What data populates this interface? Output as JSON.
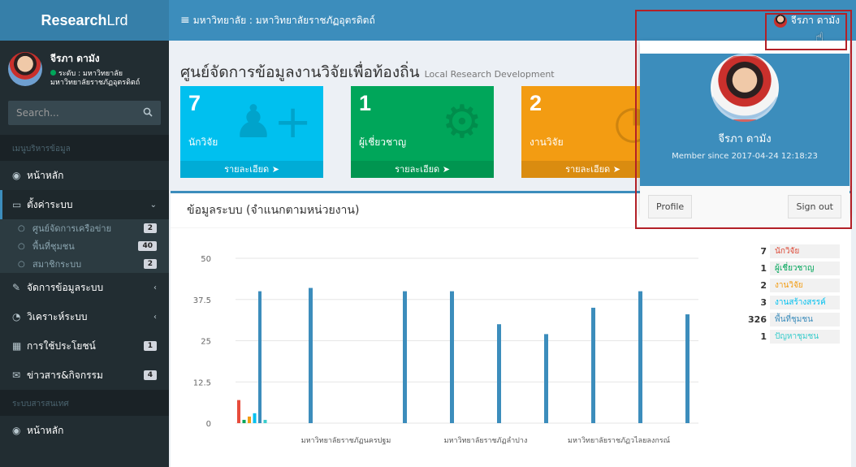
{
  "sidebar": {
    "logo_bold": "Research",
    "logo_rest": "Lrd",
    "user": {
      "name": "จีรภา ดามัง",
      "status_line1": "ระดับ : มหาวิทยาลัย",
      "status_line2": "มหาวิทยาลัยราชภัฏอุตรดิตถ์"
    },
    "search_placeholder": "Search...",
    "section1": "เมนูบริหารข้อมูล",
    "section2": "ระบบสารสนเทศ",
    "menu": {
      "home": "หน้าหลัก",
      "settings": "ตั้งค่าระบบ",
      "sub_network": "ศูนย์จัดการเครือข่าย",
      "sub_network_badge": "2",
      "sub_area": "พื้นที่ชุมชน",
      "sub_area_badge": "40",
      "sub_members": "สมาชิกระบบ",
      "sub_members_badge": "2",
      "manage": "จัดการข้อมูลระบบ",
      "analyze": "วิเคราะห์ระบบ",
      "usage": "การใช้ประโยชน์",
      "usage_badge": "1",
      "news": "ข่าวสาร&กิจกรรม",
      "news_badge": "4",
      "home2": "หน้าหลัก"
    }
  },
  "navbar": {
    "breadcrumb": "มหาวิทยาลัย : มหาวิทยาลัยราชภัฏอุตรดิตถ์",
    "user_name": "จีรภา ดามัง"
  },
  "page": {
    "title": "ศูนย์จัดการข้อมูลงานวิจัยเพื่อท้องถิ่น",
    "subtitle": "Local Research Development"
  },
  "stats": [
    {
      "value": "7",
      "label": "นักวิจัย",
      "more": "รายละเอียด",
      "color": "#00c0ef"
    },
    {
      "value": "1",
      "label": "ผู้เชี่ยวชาญ",
      "more": "รายละเอียด",
      "color": "#00a65a"
    },
    {
      "value": "2",
      "label": "งานวิจัย",
      "more": "รายละเอียด",
      "color": "#f39c12"
    }
  ],
  "box": {
    "title": "ข้อมูลระบบ (จำแนกตามหน่วยงาน)"
  },
  "chart_data": {
    "type": "bar",
    "ylim": [
      0,
      50
    ],
    "yticks": [
      "50",
      "37.5",
      "25",
      "12.5",
      "0"
    ],
    "xtick_labels": [
      "มหาวิทยาลัยราชภัฏนครปฐม",
      "มหาวิทยาลัยราชภัฏลำปาง",
      "มหาวิทยาลัยราชภัฏวไลยลงกรณ์"
    ],
    "first_group_values": [
      7,
      1,
      2,
      3,
      40,
      1
    ],
    "first_group_colors": [
      "#e74c3c",
      "#00a65a",
      "#f39c12",
      "#00c0ef",
      "#3c8dbc",
      "#39cccc"
    ],
    "area_values": [
      41,
      40,
      40,
      30,
      27,
      35,
      40,
      33
    ],
    "legend": [
      {
        "value": "7",
        "label": "นักวิจัย",
        "color": "#dd4b39"
      },
      {
        "value": "1",
        "label": "ผู้เชี่ยวชาญ",
        "color": "#00a65a"
      },
      {
        "value": "2",
        "label": "งานวิจัย",
        "color": "#f39c12"
      },
      {
        "value": "3",
        "label": "งานสร้างสรรค์",
        "color": "#00c0ef"
      },
      {
        "value": "326",
        "label": "พื้นที่ชุมชน",
        "color": "#3c8dbc"
      },
      {
        "value": "1",
        "label": "ปัญหาชุมชน",
        "color": "#39cccc"
      }
    ]
  },
  "dropdown": {
    "name": "จีรภา ดามัง",
    "member_since": "Member since 2017-04-24 12:18:23",
    "profile_label": "Profile",
    "signout_label": "Sign out"
  }
}
